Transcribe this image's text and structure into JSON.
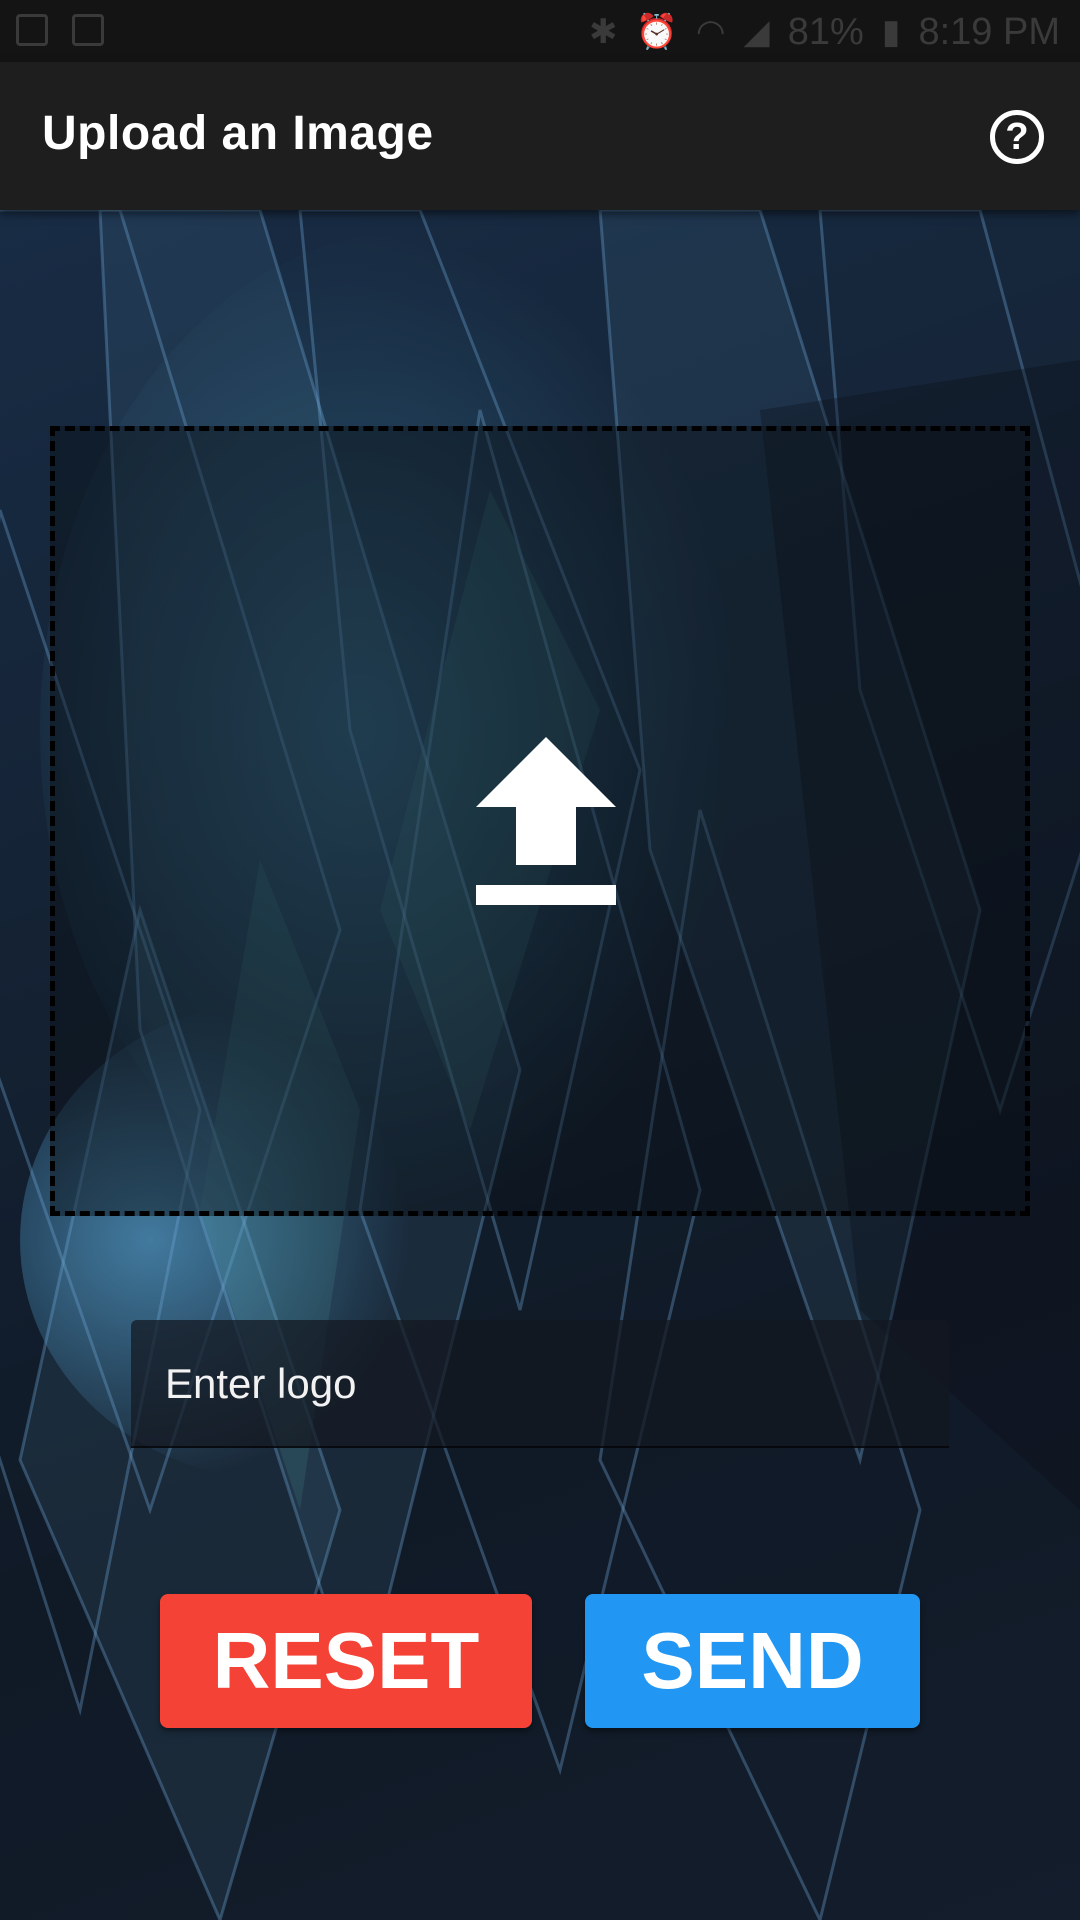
{
  "status_bar": {
    "battery": "81%",
    "time": "8:19 PM",
    "icons": [
      "image-icon",
      "news-icon",
      "bluetooth-icon",
      "alarm-icon",
      "wifi-icon",
      "signal-icon",
      "battery-icon"
    ]
  },
  "app_bar": {
    "title": "Upload an Image",
    "help_icon": "help-circle-icon",
    "help_glyph": "?"
  },
  "upload_zone": {
    "icon": "upload-icon"
  },
  "logo_input": {
    "placeholder": "Enter logo",
    "value": ""
  },
  "buttons": {
    "reset_label": "RESET",
    "send_label": "SEND"
  },
  "colors": {
    "app_bar": "#1e1e1e",
    "reset": "#f44336",
    "send": "#2196f3",
    "text": "#ffffff"
  }
}
